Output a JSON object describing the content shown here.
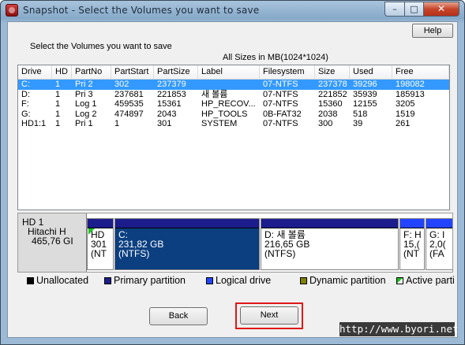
{
  "window": {
    "title": "Snapshot - Select the Volumes you want to save",
    "minimize": "–",
    "maximize": "□",
    "close": "✕"
  },
  "help_label": "Help",
  "instructions": "Select the Volumes you want to save",
  "sizes_note": "All Sizes in MB(1024*1024)",
  "table": {
    "columns": [
      "Drive",
      "HD",
      "PartNo",
      "PartStart",
      "PartSize",
      "Label",
      "Filesystem",
      "Size",
      "Used",
      "Free"
    ],
    "rows": [
      [
        "C:",
        "1",
        "Pri 2",
        "302",
        "237379",
        "",
        "07-NTFS",
        "237378",
        "39296",
        "198082"
      ],
      [
        "D:",
        "1",
        "Pri 3",
        "237681",
        "221853",
        "새 볼륨",
        "07-NTFS",
        "221852",
        "35939",
        "185913"
      ],
      [
        "F:",
        "1",
        "Log 1",
        "459535",
        "15361",
        "HP_RECOV...",
        "07-NTFS",
        "15360",
        "12155",
        "3205"
      ],
      [
        "G:",
        "1",
        "Log 2",
        "474897",
        "2043",
        "HP_TOOLS",
        "0B-FAT32",
        "2038",
        "518",
        "1519"
      ],
      [
        "HD1:1",
        "1",
        "Pri 1",
        "1",
        "301",
        "SYSTEM",
        "07-NTFS",
        "300",
        "39",
        "261"
      ]
    ],
    "selected_row": 0
  },
  "disk_map": {
    "disk": {
      "name": "HD 1",
      "model": "Hitachi H",
      "size": "465,76 GI"
    },
    "segments": [
      {
        "line1": "HD",
        "line2": "301",
        "line3": "(NT",
        "type": "primary",
        "active": true,
        "selected": false
      },
      {
        "line1": "C:",
        "line2": "231,82 GB",
        "line3": "(NTFS)",
        "type": "primary",
        "active": false,
        "selected": true
      },
      {
        "line1": "D: 새 볼륨",
        "line2": "216,65 GB",
        "line3": "(NTFS)",
        "type": "primary",
        "active": false,
        "selected": false
      },
      {
        "line1": "F: H",
        "line2": "15,(",
        "line3": "(NT",
        "type": "logical",
        "active": false,
        "selected": false
      },
      {
        "line1": "G: I",
        "line2": "2,0(",
        "line3": "(FA",
        "type": "logical",
        "active": false,
        "selected": false
      }
    ]
  },
  "legend": [
    {
      "label": "Unallocated",
      "color": "#000000"
    },
    {
      "label": "Primary partition",
      "color": "#1c1c8c"
    },
    {
      "label": "Logical drive",
      "color": "#2244ff"
    },
    {
      "label": "Dynamic partition",
      "color": "#808000"
    },
    {
      "label": "Active parti",
      "color": "#22c022"
    }
  ],
  "buttons": {
    "back": "Back",
    "next": "Next"
  },
  "watermark": "http://www.byori.net"
}
